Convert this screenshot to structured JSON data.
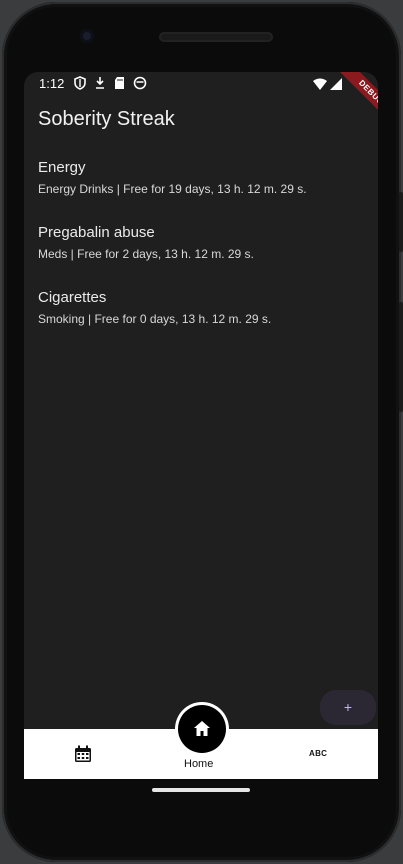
{
  "status_bar": {
    "time": "1:12",
    "left_icons": [
      "shield-icon",
      "download-icon",
      "sd-card-icon",
      "robot-icon"
    ],
    "right_icons": [
      "wifi-icon",
      "signal-icon"
    ],
    "debug_label": "DEBUG"
  },
  "app_bar": {
    "title": "Soberity Streak"
  },
  "streaks": [
    {
      "title": "Energy",
      "subtitle": "Energy Drinks | Free for 19 days, 13 h. 12 m. 29 s."
    },
    {
      "title": "Pregabalin abuse",
      "subtitle": "Meds | Free for 2 days, 13 h. 12 m. 29 s."
    },
    {
      "title": "Cigarettes",
      "subtitle": "Smoking | Free for 0 days, 13 h. 12 m. 29 s."
    }
  ],
  "fab": {
    "label": "+"
  },
  "bottom_nav": {
    "items": [
      {
        "icon": "calendar-icon"
      },
      {
        "icon": "home-icon",
        "label": "Home",
        "selected": true
      },
      {
        "icon": "abc-icon",
        "text": "ABC"
      }
    ]
  },
  "colors": {
    "screen_bg": "#1f1f1f",
    "nav_bg": "#ffffff",
    "fab_bg": "#2b2833",
    "debug_banner": "#8b1a1f"
  }
}
